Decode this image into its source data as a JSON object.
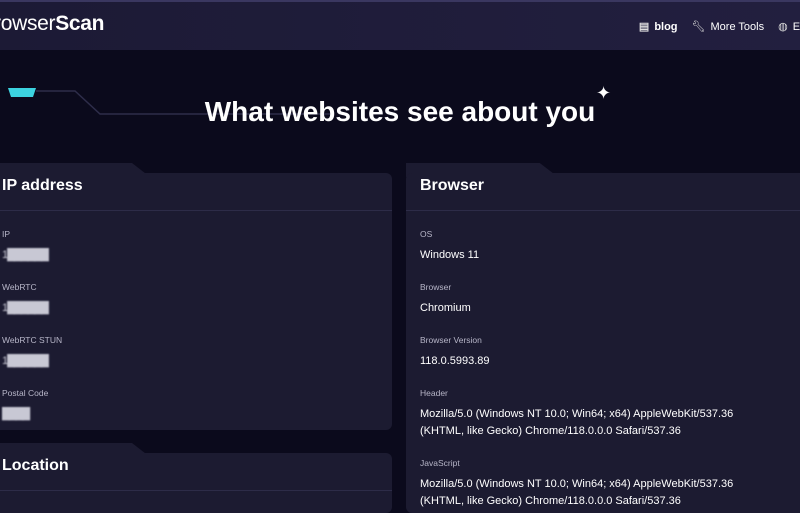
{
  "header": {
    "logo_a": "rowser",
    "logo_b": "Scan",
    "nav": [
      {
        "icon": "blog-icon",
        "label": "blog"
      },
      {
        "icon": "wrench-icon",
        "label": "More Tools"
      },
      {
        "icon": "globe-icon",
        "label": "EN"
      }
    ]
  },
  "hero": {
    "title": "What websites see about you"
  },
  "ip_card": {
    "title": "IP address",
    "fields": [
      {
        "label": "IP",
        "value": "1██████"
      },
      {
        "label": "WebRTC",
        "value": "1██████"
      },
      {
        "label": "WebRTC STUN",
        "value": "1██████"
      },
      {
        "label": "Postal Code",
        "value": "████"
      }
    ]
  },
  "browser_card": {
    "title": "Browser",
    "fields": [
      {
        "label": "OS",
        "value": "Windows 11"
      },
      {
        "label": "Browser",
        "value": "Chromium"
      },
      {
        "label": "Browser Version",
        "value": "118.0.5993.89"
      },
      {
        "label": "Header",
        "value": "Mozilla/5.0 (Windows NT 10.0; Win64; x64) AppleWebKit/537.36 (KHTML, like Gecko) Chrome/118.0.0.0 Safari/537.36"
      },
      {
        "label": "JavaScript",
        "value": "Mozilla/5.0 (Windows NT 10.0; Win64; x64) AppleWebKit/537.36 (KHTML, like Gecko) Chrome/118.0.0.0 Safari/537.36"
      }
    ]
  },
  "location_card": {
    "title": "Location"
  }
}
